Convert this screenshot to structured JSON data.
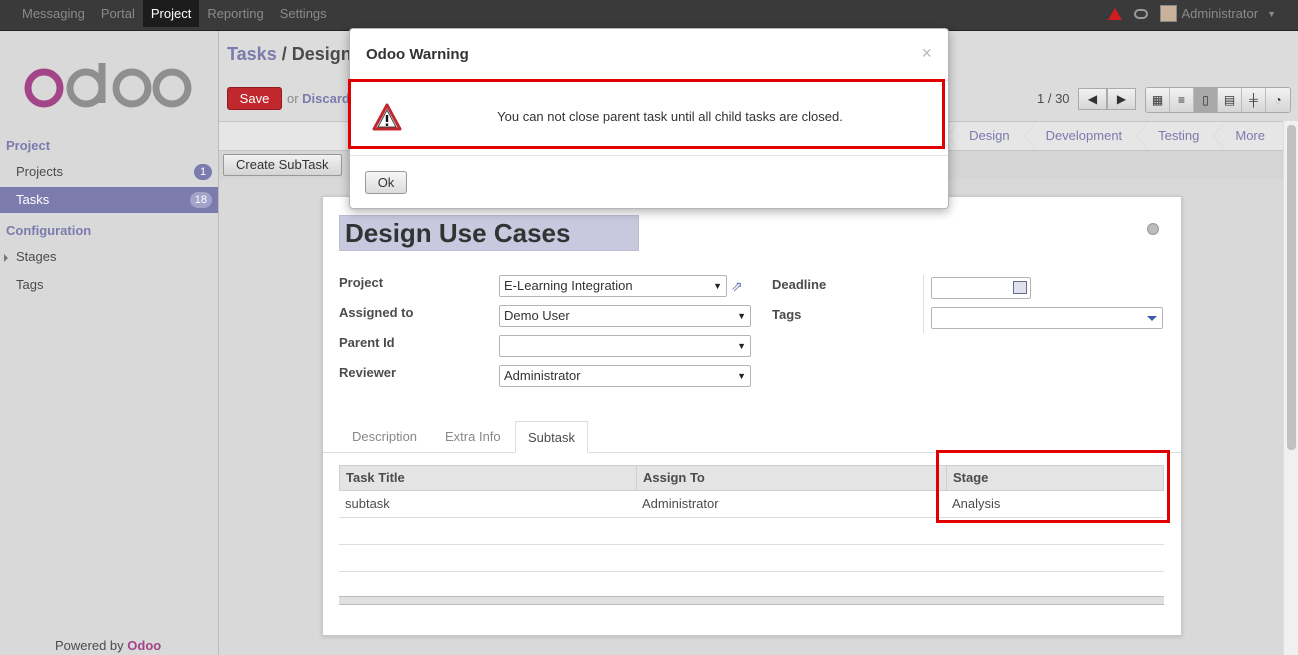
{
  "topbar": {
    "menu": [
      "Messaging",
      "Portal",
      "Project",
      "Reporting",
      "Settings"
    ],
    "active": "Project",
    "user": "Administrator"
  },
  "sidebar": {
    "section_project": "Project",
    "items": [
      {
        "label": "Projects",
        "badge": "1"
      },
      {
        "label": "Tasks",
        "badge": "18"
      }
    ],
    "section_config": "Configuration",
    "config_items": [
      {
        "label": "Stages"
      },
      {
        "label": "Tags"
      }
    ],
    "powered_prefix": "Powered by ",
    "powered_brand": "Odoo"
  },
  "header": {
    "breadcrumb_parent": "Tasks",
    "breadcrumb_sep": " / ",
    "breadcrumb_current": "Design Use Cases",
    "save_label": "Save",
    "or_label": "or ",
    "discard_label": "Discard",
    "pager": "1 / 30"
  },
  "stages": [
    "Design",
    "Development",
    "Testing",
    "More"
  ],
  "toolbar": {
    "create_subtask": "Create SubTask"
  },
  "form": {
    "title": "Design Use Cases",
    "fields_left": [
      {
        "label": "Project",
        "value": "E-Learning Integration"
      },
      {
        "label": "Assigned to",
        "value": "Demo User"
      },
      {
        "label": "Parent Id",
        "value": ""
      },
      {
        "label": "Reviewer",
        "value": "Administrator"
      }
    ],
    "fields_right": [
      {
        "label": "Deadline",
        "value": ""
      },
      {
        "label": "Tags",
        "value": ""
      }
    ],
    "tabs": [
      "Description",
      "Extra Info",
      "Subtask"
    ],
    "active_tab": "Subtask"
  },
  "subtask_table": {
    "columns": [
      "Task Title",
      "Assign To",
      "Stage"
    ],
    "rows": [
      [
        "subtask",
        "Administrator",
        "Analysis"
      ]
    ]
  },
  "modal": {
    "title": "Odoo Warning",
    "close": "×",
    "message": "You can not close parent task until all child tasks are closed.",
    "ok_label": "Ok"
  },
  "colors": {
    "brand": "#7c7bad",
    "save": "#c1282e",
    "highlight": "#e00000",
    "odoo_purple": "#a24689"
  }
}
